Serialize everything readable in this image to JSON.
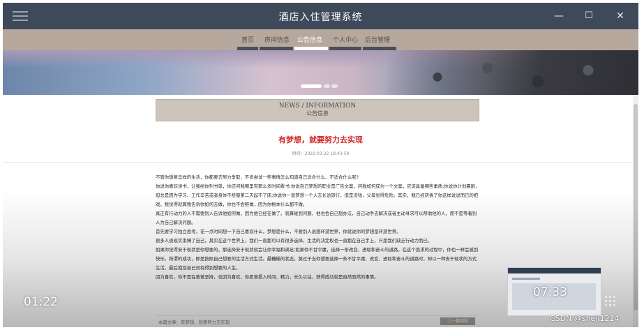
{
  "app": {
    "title": "酒店入住管理系统"
  },
  "window_controls": {
    "minimize": "—",
    "maximize": "☐",
    "close": "✕"
  },
  "nav": {
    "items": [
      "首页",
      "房间信息",
      "公告信息",
      "个人中心",
      "后台管理"
    ],
    "active_index": 2
  },
  "banner": {
    "slide_count": 3,
    "active_slide": 0
  },
  "section": {
    "title_en": "NEWS / INFORMATION",
    "title_cn": "公告信息"
  },
  "article": {
    "title": "有梦想，就要努力去实现",
    "time": "时间：2022-03-22 18:43:59",
    "paragraphs": [
      "不管你想要怎样的生活，你都要去努力争取，不多尝试一些事情怎么知道自己适合什么、不适合什么呢?",
      "你说你喜欢读书，让我给你列书单，你还问我哪里有那么多时间看书;你说自己梦想的职业是广告文案，问我如何成为一个文案，应该具备哪些素质;你说你计划晨跑，但总是因为学习、工作辛苦或者身体不舒服第二天起不了床;你说你一直梦想一个人去长途旅行，但是没钱，父母觉得危险。其实，我已经厌倦了你这样说说而已的把戏，我觉得就算我告诉你如何去做，你也不会照做，因为你根本什么都不做。",
      "真正有行动力的人不需要别人告诉他如何做，因为他已经在做了。就算碰到问题，他也会自己想办法，自己动手去解决或者主动寻求可以帮助他的人，而不是等着别人为自己解决问题。",
      "首先要学习独立思考。花一点时间想一下自己喜欢什么，梦想是什么，不要别人说想环游世界，你就说你的梦想是环游世界。",
      "很多人说现实束缚了自己，其实在这个世界上，我们一直都可以有很多选择，生活的决定权也一直都在自己手上，只是我们缺乏行动力而已。",
      "如果你觉得安于现状是你想要的，那选择安于现状就会让你幸福和满足;如果你不甘平庸，选择一条改变、进取和奋斗的道路，在这个追求的过程中，你也一样会感到快乐。所谓的成功，即是按照自己想要的生活方式生活。最糟糕的状态，莫过于当你想要选择一条不甘平庸、改变、进取和奋斗的道路时，却以一种安于现状的方式生活，最后抱怨自己没有得到想要的人生。",
      "因为喜欢，你不是在苦苦坚持，也因为喜欢，你愿意投入时间、精力，长久以往，获得成功就是自然而然的事情。"
    ]
  },
  "footer": {
    "current": "本篇文章：有梦想，就要努力去实现",
    "prev_button": "上一篇回顾"
  },
  "video": {
    "elapsed": "01:22",
    "preview_time": "07:33"
  },
  "watermark": "CSDN @sheji1214"
}
